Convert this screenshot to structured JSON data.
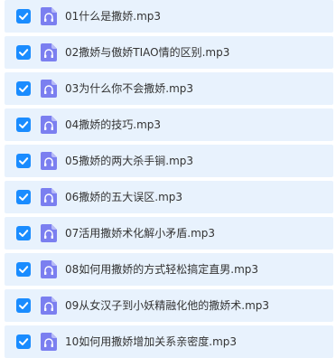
{
  "colors": {
    "row_background": "#e8f2fd",
    "checkbox_checked": "#1a8cff",
    "audio_icon": "#7b7ff0",
    "text": "#333333"
  },
  "file_list": {
    "items": [
      {
        "name": "01什么是撒娇.mp3",
        "checked": true,
        "icon": "audio-file-icon"
      },
      {
        "name": "02撒娇与傲娇TIAO情的区别.mp3",
        "checked": true,
        "icon": "audio-file-icon"
      },
      {
        "name": "03为什么你不会撒娇.mp3",
        "checked": true,
        "icon": "audio-file-icon"
      },
      {
        "name": "04撒娇的技巧.mp3",
        "checked": true,
        "icon": "audio-file-icon"
      },
      {
        "name": "05撒娇的两大杀手锏.mp3",
        "checked": true,
        "icon": "audio-file-icon"
      },
      {
        "name": "06撒娇的五大误区.mp3",
        "checked": true,
        "icon": "audio-file-icon"
      },
      {
        "name": "07活用撒娇术化解小矛盾.mp3",
        "checked": true,
        "icon": "audio-file-icon"
      },
      {
        "name": "08如何用撒娇的方式轻松搞定直男.mp3",
        "checked": true,
        "icon": "audio-file-icon"
      },
      {
        "name": "09从女汉子到小妖精融化他的撒娇术.mp3",
        "checked": true,
        "icon": "audio-file-icon"
      },
      {
        "name": "10如何用撒娇增加关系亲密度.mp3",
        "checked": true,
        "icon": "audio-file-icon"
      }
    ]
  }
}
